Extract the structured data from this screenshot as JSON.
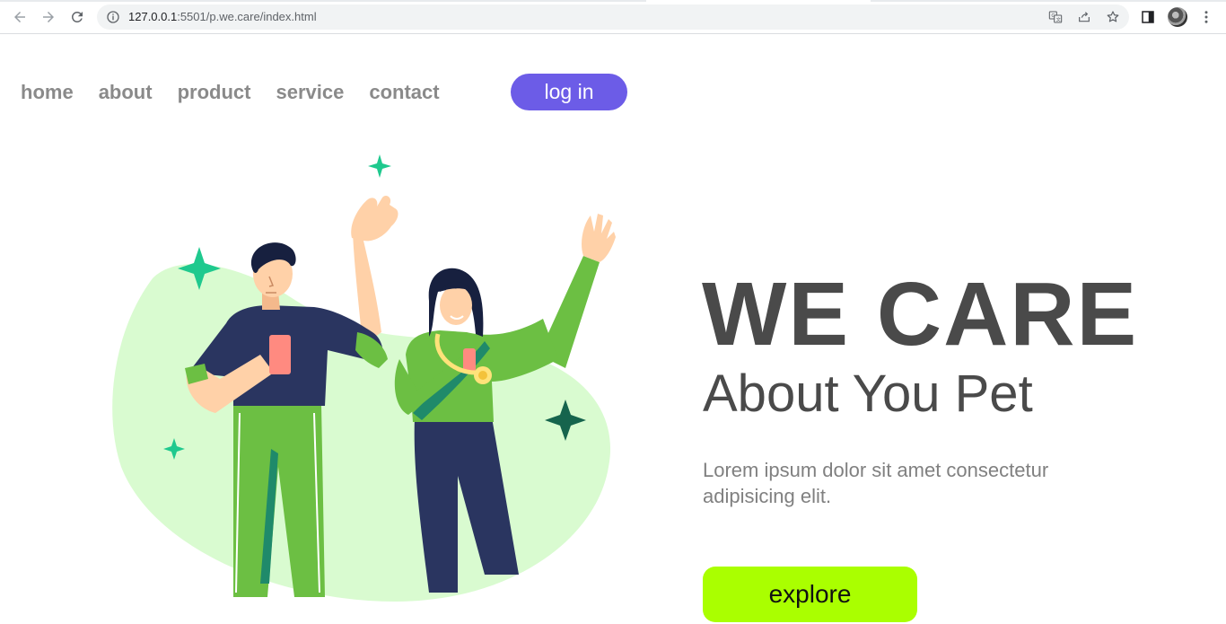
{
  "browser": {
    "url_host": "127.0.0.1",
    "url_rest": ":5501/p.we.care/index.html"
  },
  "nav": {
    "items": [
      {
        "label": "home"
      },
      {
        "label": "about"
      },
      {
        "label": "product"
      },
      {
        "label": "service"
      },
      {
        "label": "contact"
      }
    ],
    "login_label": "log in"
  },
  "hero": {
    "title": "WE CARE",
    "subtitle": "About You Pet",
    "description": "Lorem ipsum dolor sit amet consectetur adipisicing elit.",
    "explore_label": "explore"
  },
  "colors": {
    "accent_purple": "#6c5ce7",
    "accent_lime": "#aaff00",
    "blob_green": "#d9fbd0",
    "shirt_green": "#6cbf43",
    "navy": "#2a3560",
    "sparkle": "#1fc98e"
  }
}
